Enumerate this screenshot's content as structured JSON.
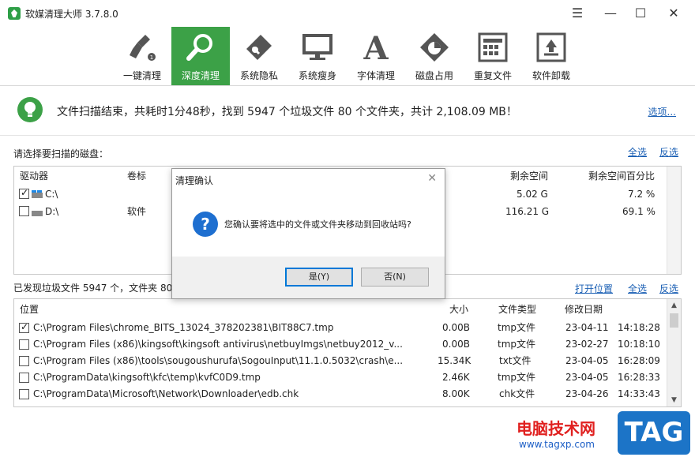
{
  "window": {
    "title": "软媒清理大师 3.7.8.0",
    "menu_icon": "hamburger-icon",
    "controls": [
      "—",
      "☐",
      "✕"
    ]
  },
  "toolbar": {
    "items": [
      {
        "label": "一键清理",
        "icon": "broom-icon",
        "active": false
      },
      {
        "label": "深度清理",
        "icon": "magnifier-icon",
        "active": true
      },
      {
        "label": "系统隐私",
        "icon": "eraser-icon",
        "active": false
      },
      {
        "label": "系统瘦身",
        "icon": "monitor-icon",
        "active": false
      },
      {
        "label": "字体清理",
        "icon": "font-a-icon",
        "active": false
      },
      {
        "label": "磁盘占用",
        "icon": "disk-pie-icon",
        "active": false
      },
      {
        "label": "重复文件",
        "icon": "duplicate-grid-icon",
        "active": false
      },
      {
        "label": "软件卸载",
        "icon": "recycle-icon",
        "active": false
      }
    ]
  },
  "status": {
    "message": "文件扫描结束，共耗时1分48秒，找到 5947 个垃圾文件 80 个文件夹，共计 2,108.09 MB！",
    "options_link": "选项..."
  },
  "drives": {
    "prompt": "请选择要扫描的磁盘：",
    "select_all": "全选",
    "invert": "反选",
    "columns": {
      "drive": "驱动器",
      "volume": "卷标",
      "free": "剩余空间",
      "free_pct": "剩余空间百分比"
    },
    "rows": [
      {
        "drive": "C:\\",
        "volume": "",
        "free": "5.02 G",
        "free_pct": "7.2 %",
        "checked": true
      },
      {
        "drive": "D:\\",
        "volume": "软件",
        "free": "116.21 G",
        "free_pct": "69.1 %",
        "checked": false
      }
    ]
  },
  "files": {
    "summary": "已发现垃圾文件 5947 个，文件夹 80",
    "open_location": "打开位置",
    "select_all": "全选",
    "invert": "反选",
    "columns": {
      "path": "位置",
      "size": "大小",
      "type": "文件类型",
      "date": "修改日期"
    },
    "rows": [
      {
        "path": "C:\\Program Files\\chrome_BITS_13024_378202381\\BIT88C7.tmp",
        "size": "0.00B",
        "type": "tmp文件",
        "date": "23-04-11",
        "time": "14:18:28",
        "checked": true
      },
      {
        "path": "C:\\Program Files (x86)\\kingsoft\\kingsoft antivirus\\netbuyImgs\\netbuy2012_v...",
        "size": "0.00B",
        "type": "tmp文件",
        "date": "23-02-27",
        "time": "10:18:10",
        "checked": false
      },
      {
        "path": "C:\\Program Files (x86)\\tools\\sougoushurufa\\SogouInput\\11.1.0.5032\\crash\\e...",
        "size": "15.34K",
        "type": "txt文件",
        "date": "23-04-05",
        "time": "16:28:09",
        "checked": false
      },
      {
        "path": "C:\\ProgramData\\kingsoft\\kfc\\temp\\kvfC0D9.tmp",
        "size": "2.46K",
        "type": "tmp文件",
        "date": "23-04-05",
        "time": "16:28:33",
        "checked": false
      },
      {
        "path": "C:\\ProgramData\\Microsoft\\Network\\Downloader\\edb.chk",
        "size": "8.00K",
        "type": "chk文件",
        "date": "23-04-26",
        "time": "14:33:43",
        "checked": false
      }
    ]
  },
  "dialog": {
    "title": "清理确认",
    "message": "您确认要将选中的文件或文件夹移动到回收站吗?",
    "yes": "是(Y)",
    "no": "否(N)",
    "icon": "question-icon"
  },
  "watermark": {
    "text": "电脑技术网",
    "url": "www.tagxp.com",
    "badge": "TAG"
  },
  "colors": {
    "accent_green": "#3ca147",
    "link_blue": "#1a5fb4",
    "dialog_question": "#1e6fd0"
  }
}
